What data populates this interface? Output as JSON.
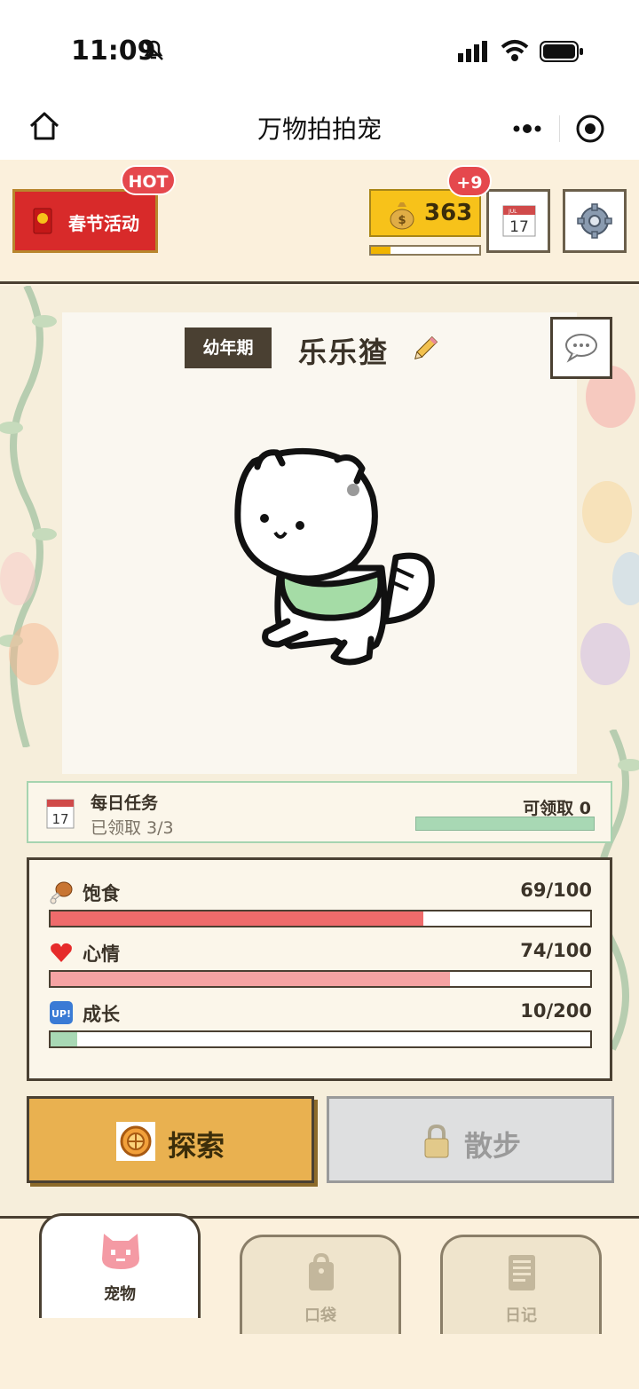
{
  "status_bar": {
    "time": "11:09"
  },
  "nav": {
    "title": "万物拍拍宠"
  },
  "header": {
    "event_label": "春节活动",
    "hot_badge": "HOT",
    "coins": "363",
    "coin_progress": 0.18,
    "plus_badge": "+9",
    "calendar_day": "17",
    "calendar_month": "JUL"
  },
  "pet": {
    "stage": "幼年期",
    "name": "乐乐猹"
  },
  "tasks": {
    "title": "每日任务",
    "status": "已领取 3/3",
    "claimable": "可领取 0",
    "calendar_day": "17"
  },
  "stats": [
    {
      "label": "饱食",
      "value": "69/100",
      "fraction": 0.69,
      "color": "#ef6b6b",
      "icon": "drumstick-icon"
    },
    {
      "label": "心情",
      "value": "74/100",
      "fraction": 0.74,
      "color": "#f5a3a3",
      "icon": "heart-icon"
    },
    {
      "label": "成长",
      "value": "10/200",
      "fraction": 0.05,
      "color": "#a8d8b4",
      "icon": "up-icon"
    }
  ],
  "actions": {
    "explore": "探索",
    "walk": "散步"
  },
  "tabs": [
    {
      "label": "宠物",
      "active": true
    },
    {
      "label": "口袋",
      "active": false
    },
    {
      "label": "日记",
      "active": false
    }
  ],
  "colors": {
    "accent": "#e9b150",
    "event_red": "#d82a2a",
    "coin_yellow": "#f7c21a",
    "border": "#4a4032"
  }
}
